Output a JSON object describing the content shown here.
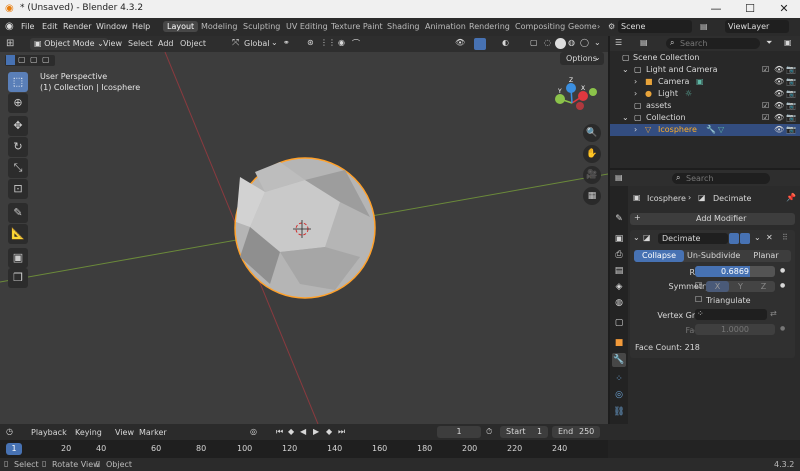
{
  "window": {
    "title": "* (Unsaved) - Blender 4.3.2",
    "minimize": "—",
    "maximize": "☐",
    "close": "✕"
  },
  "menubar": {
    "menus": [
      "File",
      "Edit",
      "Render",
      "Window",
      "Help"
    ],
    "workspaces": [
      "Layout",
      "Modeling",
      "Sculpting",
      "UV Editing",
      "Texture Paint",
      "Shading",
      "Animation",
      "Rendering",
      "Compositing",
      "Geome"
    ],
    "scene": "Scene",
    "view_layer": "ViewLayer"
  },
  "viewport_header": {
    "mode": "Object Mode",
    "menus": [
      "View",
      "Select",
      "Add",
      "Object"
    ],
    "orientation": "Global",
    "options": "Options"
  },
  "viewport": {
    "view_name": "User Perspective",
    "collection_info": "(1) Collection | Icosphere",
    "gizmo_labels": {
      "x": "X",
      "y": "Y",
      "z": "Z"
    }
  },
  "outliner": {
    "search_placeholder": "Search",
    "rows": [
      "Scene Collection",
      "Light and Camera",
      "Camera",
      "Light",
      "assets",
      "Collection",
      "Icosphere"
    ]
  },
  "properties": {
    "search_placeholder": "Search",
    "breadcrumb_object": "Icosphere",
    "breadcrumb_modifier": "Decimate",
    "add_modifier": "Add Modifier",
    "modifier_name": "Decimate",
    "tabs": [
      "Collapse",
      "Un-Subdivide",
      "Planar"
    ],
    "ratio_label": "Ratio",
    "ratio_value": "0.6869",
    "ratio_fraction": 0.6869,
    "symmetry_label": "Symmetry",
    "axes": [
      "X",
      "Y",
      "Z"
    ],
    "triangulate": "Triangulate",
    "vertex_group_label": "Vertex Group",
    "factor_label": "Factor",
    "factor_value": "1.0000",
    "face_count": "Face Count: 218"
  },
  "timeline": {
    "menus": [
      "Playback",
      "Keying",
      "View",
      "Marker"
    ],
    "current_frame": "1",
    "start_label": "Start",
    "start_value": "1",
    "end_label": "End",
    "end_value": "250",
    "ruler": [
      "1",
      "20",
      "40",
      "60",
      "80",
      "100",
      "120",
      "140",
      "160",
      "180",
      "200",
      "220",
      "240"
    ]
  },
  "statusbar": {
    "items": [
      "Select",
      "Rotate View",
      "Object"
    ],
    "version": "4.3.2"
  },
  "colors": {
    "accent": "#4772b3",
    "selection_outline": "#ffa12b",
    "x_axis": "#e0383f",
    "y_axis": "#8bc34a",
    "z_axis": "#3b8fe0"
  }
}
